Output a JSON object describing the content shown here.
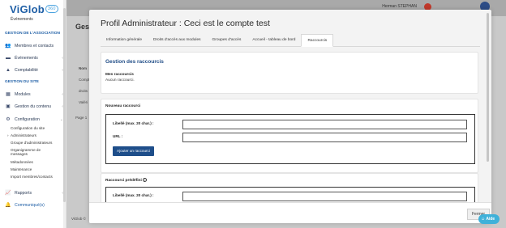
{
  "sidebar": {
    "logo": "ViGlob",
    "logo_badge": "360",
    "events_top": "Événements",
    "section_association": "GESTION DE L'ASSOCIATION",
    "members": "Membres et contacts",
    "events": "Événements",
    "accounting": "Comptabilité",
    "section_site": "GESTION DU SITE",
    "modules": "Modules",
    "content": "Gestion du contenu",
    "configuration": "Configuration",
    "sub_items": [
      "Configuration du site",
      "Administrateurs",
      "Groupe d'administrateurs",
      "Organigramme de messages",
      "Métadonnées",
      "Maintenance",
      "Import membres/contacts"
    ],
    "reports": "Rapports",
    "communique": "Communiqué(s)"
  },
  "background": {
    "title": "Gest",
    "user": "Herman STEPHAN",
    "col_name": "Nom",
    "row1": "Compt",
    "row2": "droits",
    "row3": "Valéri",
    "page": "Page 1",
    "footer": "ViGlob ©"
  },
  "modal": {
    "title": "Profil Administrateur : Ceci est le compte test",
    "tabs": [
      "Information générale",
      "Droits d'accès aux modules",
      "Groupes d'accès",
      "Accueil - tableau de bord",
      "Raccourcis"
    ],
    "active_tab": "Raccourcis",
    "section_title": "Gestion des raccourcis",
    "my_shortcuts_label": "Mes raccourcis",
    "no_shortcut": "Aucun raccourci.",
    "new_shortcut_label": "Nouveau raccourci",
    "libelle_label": "Libellé (max. 20 char.) :",
    "url_label": "URL :",
    "add_button": "Ajouter un raccourci",
    "predefined_label": "Raccourci prédéfini",
    "libelle_label_2": "Libellé (max. 20 char.) :",
    "close_button": "Fermer"
  },
  "help": "Aide",
  "colors": {
    "brand": "#1f5fa6",
    "primary_button": "#1e4e8a",
    "help": "#3fb1d9"
  }
}
